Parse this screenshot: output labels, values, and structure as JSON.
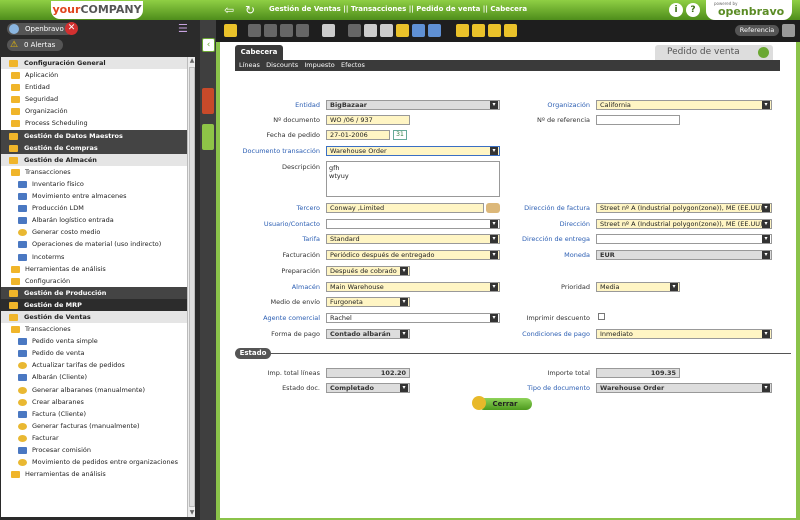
{
  "header": {
    "company": "your",
    "company_bold": "COMPANY",
    "breadcrumb": "Gestión de Ventas || Transacciones || Pedido de venta  ||  Cabecera",
    "powered_by": "powered by",
    "brand": "openbravo"
  },
  "user": {
    "name": "Openbravo",
    "alerts": "0 Alertas"
  },
  "tree": [
    {
      "label": "Configuración General",
      "kind": "sec2",
      "icon": "gear-icon"
    },
    {
      "label": "Aplicación",
      "kind": "l1",
      "icon": "folder-icon"
    },
    {
      "label": "Entidad",
      "kind": "l1",
      "icon": "folder-icon"
    },
    {
      "label": "Seguridad",
      "kind": "l1",
      "icon": "folder-icon"
    },
    {
      "label": "Organización",
      "kind": "l1",
      "icon": "folder-icon"
    },
    {
      "label": "Process Scheduling",
      "kind": "l1",
      "icon": "folder-icon"
    },
    {
      "label": "Gestión de Datos Maestros",
      "kind": "sec",
      "icon": "database-icon"
    },
    {
      "label": "Gestión de Compras",
      "kind": "sec",
      "icon": "cart-icon"
    },
    {
      "label": "Gestión de Almacén",
      "kind": "sec2",
      "icon": "warehouse-icon"
    },
    {
      "label": "Transacciones",
      "kind": "l1",
      "icon": "folder-icon"
    },
    {
      "label": "Inventario físico",
      "kind": "l2",
      "icon": "document-icon"
    },
    {
      "label": "Movimiento entre almacenes",
      "kind": "l2",
      "icon": "document-icon"
    },
    {
      "label": "Producción LDM",
      "kind": "l2",
      "icon": "document-icon"
    },
    {
      "label": "Albarán logístico entrada",
      "kind": "l2",
      "icon": "document-icon"
    },
    {
      "label": "Generar costo medio",
      "kind": "l2",
      "icon": "process-icon"
    },
    {
      "label": "Operaciones de material (uso indirecto)",
      "kind": "l2",
      "icon": "document-icon"
    },
    {
      "label": "Incoterms",
      "kind": "l2",
      "icon": "document-icon"
    },
    {
      "label": "Herramientas de análisis",
      "kind": "l1",
      "icon": "folder-icon"
    },
    {
      "label": "Configuración",
      "kind": "l1",
      "icon": "folder-icon"
    },
    {
      "label": "Gestión de Producción",
      "kind": "sec",
      "icon": "production-icon"
    },
    {
      "label": "Gestión de MRP",
      "kind": "sec dark",
      "icon": "mrp-icon"
    },
    {
      "label": "Gestión de Ventas",
      "kind": "sec2",
      "icon": "sales-icon"
    },
    {
      "label": "Transacciones",
      "kind": "l1",
      "icon": "folder-icon"
    },
    {
      "label": "Pedido venta simple",
      "kind": "l2",
      "icon": "document-icon"
    },
    {
      "label": "Pedido de venta",
      "kind": "l2",
      "icon": "document-icon"
    },
    {
      "label": "Actualizar tarifas de pedidos",
      "kind": "l2",
      "icon": "process-icon"
    },
    {
      "label": "Albarán (Cliente)",
      "kind": "l2",
      "icon": "document-icon"
    },
    {
      "label": "Generar albaranes (manualmente)",
      "kind": "l2",
      "icon": "process-icon"
    },
    {
      "label": "Crear albaranes",
      "kind": "l2",
      "icon": "process-icon"
    },
    {
      "label": "Factura (Cliente)",
      "kind": "l2",
      "icon": "document-icon"
    },
    {
      "label": "Generar facturas (manualmente)",
      "kind": "l2",
      "icon": "process-icon"
    },
    {
      "label": "Facturar",
      "kind": "l2",
      "icon": "process-icon"
    },
    {
      "label": "Procesar comisión",
      "kind": "l2",
      "icon": "document-icon"
    },
    {
      "label": "Movimiento de pedidos entre organizaciones",
      "kind": "l2",
      "icon": "process-icon"
    },
    {
      "label": "Herramientas de análisis",
      "kind": "l1",
      "icon": "folder-icon"
    }
  ],
  "toolbar": {
    "reference_label": "Referencia"
  },
  "tabs": {
    "main": "Cabecera",
    "window_title": "Pedido de venta",
    "subtabs": [
      "Líneas",
      "Discounts",
      "Impuesto",
      "Efectos"
    ]
  },
  "form": {
    "entidad_label": "Entidad",
    "entidad": "BigBazaar",
    "organizacion_label": "Organización",
    "organizacion": "California",
    "ndoc_label": "Nº documento",
    "ndoc": "WO /06 / 937",
    "nref_label": "Nº de referencia",
    "nref": "",
    "fecha_label": "Fecha de pedido",
    "fecha": "27-01-2006",
    "tipo_trans_label": "Documento transacción",
    "tipo_trans": "Warehouse Order",
    "descripcion_label": "Descripción",
    "descripcion_1": "gfh",
    "descripcion_2": "wtyuy",
    "tercero_label": "Tercero",
    "tercero": "Conway ,Limited",
    "dir_factura_label": "Dirección de factura",
    "dir_factura": "Street nº A (Industrial polygon(zone)), ME (EE.UU)",
    "usuario_label": "Usuario/Contacto",
    "usuario": "",
    "direccion_label": "Dirección",
    "direccion": "Street nº A (Industrial polygon(zone)), ME (EE.UU)",
    "tarifa_label": "Tarifa",
    "tarifa": "Standard",
    "dir_entrega_label": "Dirección de entrega",
    "dir_entrega": "",
    "facturacion_label": "Facturación",
    "facturacion": "Periódico después de entregado",
    "moneda_label": "Moneda",
    "moneda": "EUR",
    "preparacion_label": "Preparación",
    "preparacion": "Después de cobrado",
    "almacen_label": "Almacén",
    "almacen": "Main Warehouse",
    "prioridad_label": "Prioridad",
    "prioridad": "Media",
    "envio_label": "Medio de envío",
    "envio": "Furgoneta",
    "agente_label": "Agente comercial",
    "agente": "Rachel",
    "imprimir_label": "Imprimir descuento",
    "forma_pago_label": "Forma de pago",
    "forma_pago": "Contado albarán",
    "condiciones_label": "Condiciones de pago",
    "condiciones": "Inmediato"
  },
  "estado": {
    "title": "Estado",
    "imp_lineas_label": "Imp. total líneas",
    "imp_lineas": "102.20",
    "importe_total_label": "Importe total",
    "importe_total": "109.35",
    "estado_doc_label": "Estado doc.",
    "estado_doc": "Completado",
    "tipo_doc_label": "Tipo de documento",
    "tipo_doc": "Warehouse Order",
    "cerrar_label": "Cerrar"
  }
}
